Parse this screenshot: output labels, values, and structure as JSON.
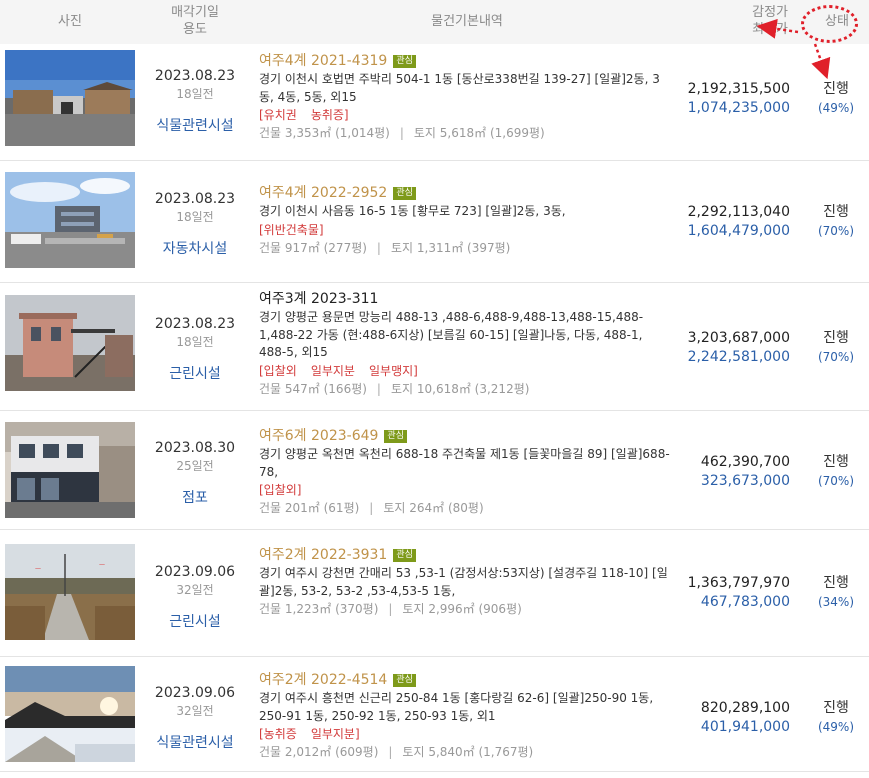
{
  "header": {
    "photo": "사진",
    "date_line1": "매각기일",
    "date_line2": "용도",
    "info": "물건기본내역",
    "price_line1": "감정가",
    "price_line2": "최저가",
    "status": "상태"
  },
  "colors": {
    "accent_blue": "#2b5fa8",
    "case_gold": "#c0934a",
    "tag_red": "#d23a3a",
    "badge_green": "#7e9a1a",
    "annotation_red": "#e0202a"
  },
  "rows": [
    {
      "date": "2023.08.23",
      "days": "18일전",
      "use": "식물관련시설",
      "court": "여주4계",
      "case": "2021-4319",
      "badge": "관심",
      "addr": "경기 이천시 호법면 주박리 504-1 1동 [동산로338번길 139-27] [일괄]2동, 3동, 4동, 5동, 외15",
      "tags": [
        "[유치권",
        "농취증]"
      ],
      "building": "건물 3,353㎡ (1,014평)",
      "land": "토지 5,618㎡ (1,699평)",
      "appraisal": "2,192,315,500",
      "min": "1,074,235,000",
      "status": "진행",
      "pct": "(49%)",
      "thumb": "warehouse-photo"
    },
    {
      "date": "2023.08.23",
      "days": "18일전",
      "use": "자동차시설",
      "court": "여주4계",
      "case": "2022-2952",
      "badge": "관심",
      "addr": "경기 이천시 사음동 16-5 1동 [황무로 723] [일괄]2동, 3동,",
      "tags": [
        "[위반건축물]"
      ],
      "building": "건물 917㎡ (277평)",
      "land": "토지 1,311㎡ (397평)",
      "appraisal": "2,292,113,040",
      "min": "1,604,479,000",
      "status": "진행",
      "pct": "(70%)",
      "thumb": "garage-photo"
    },
    {
      "date": "2023.08.23",
      "days": "18일전",
      "use": "근린시설",
      "court": "여주3계",
      "case": "2023-311",
      "badge": "",
      "addr": "경기 양평군 용문면 망능리 488-13 ,488-6,488-9,488-13,488-15,488-1,488-22 가동 (현:488-6지상) [보름길 60-15] [일괄]나동, 다동, 488-1, 488-5, 외15",
      "tags": [
        "[입찰외",
        "일부지분",
        "일부맹지]"
      ],
      "building": "건물 547㎡ (166평)",
      "land": "토지 10,618㎡ (3,212평)",
      "appraisal": "3,203,687,000",
      "min": "2,242,581,000",
      "status": "진행",
      "pct": "(70%)",
      "thumb": "house-photo"
    },
    {
      "date": "2023.08.30",
      "days": "25일전",
      "use": "점포",
      "court": "여주6계",
      "case": "2023-649",
      "badge": "관심",
      "addr": "경기 양평군 옥천면 옥천리 688-18 주건축물 제1동 [들꽃마을길 89] [일괄]688-78,",
      "tags": [
        "[입찰외]"
      ],
      "building": "건물 201㎡ (61평)",
      "land": "토지 264㎡ (80평)",
      "appraisal": "462,390,700",
      "min": "323,673,000",
      "status": "진행",
      "pct": "(70%)",
      "thumb": "store-photo"
    },
    {
      "date": "2023.09.06",
      "days": "32일전",
      "use": "근린시설",
      "court": "여주2계",
      "case": "2022-3931",
      "badge": "관심",
      "addr": "경기 여주시 강천면 간매리 53 ,53-1 (감정서상:53지상) [설경주길 118-10] [일괄]2동, 53-2, 53-2 ,53-4,53-5 1동,",
      "tags": [],
      "building": "건물 1,223㎡ (370평)",
      "land": "토지 2,996㎡ (906평)",
      "appraisal": "1,363,797,970",
      "min": "467,783,000",
      "status": "진행",
      "pct": "(34%)",
      "thumb": "field-road-photo"
    },
    {
      "date": "2023.09.06",
      "days": "32일전",
      "use": "식물관련시설",
      "court": "여주2계",
      "case": "2022-4514",
      "badge": "관심",
      "addr": "경기 여주시 흥천면 신근리 250-84 1동 [홍다랑길 62-6] [일괄]250-90 1동, 250-91 1동, 250-92 1동, 250-93 1동, 외1",
      "tags": [
        "[농취증",
        "일부지분]"
      ],
      "building": "건물 2,012㎡ (609평)",
      "land": "토지 5,840㎡ (1,767평)",
      "appraisal": "820,289,100",
      "min": "401,941,000",
      "status": "진행",
      "pct": "(49%)",
      "thumb": "greenhouse-snow-photo"
    }
  ]
}
